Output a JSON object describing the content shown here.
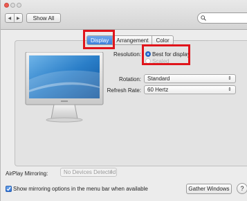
{
  "toolbar": {
    "back_glyph": "◀",
    "forward_glyph": "▶",
    "show_all_label": "Show All",
    "search": {
      "value": "",
      "placeholder": ""
    }
  },
  "tabs": [
    {
      "label": "Display",
      "active": true
    },
    {
      "label": "Arrangement",
      "active": false
    },
    {
      "label": "Color",
      "active": false
    }
  ],
  "display": {
    "resolution_label": "Resolution:",
    "resolution_options": [
      {
        "label": "Best for display",
        "selected": true
      },
      {
        "label": "Scaled",
        "selected": false
      }
    ],
    "rotation_label": "Rotation:",
    "rotation_value": "Standard",
    "refresh_label": "Refresh Rate:",
    "refresh_value": "60 Hertz"
  },
  "airplay": {
    "label": "AirPlay Mirroring:",
    "value": "No Devices Detected"
  },
  "mirroring_checkbox": {
    "label": "Show mirroring options in the menu bar when available",
    "checked": true
  },
  "gather_windows_label": "Gather Windows",
  "help_glyph": "?",
  "colors": {
    "accent": "#3b7fdc",
    "annotation": "#e0141b",
    "close": "#ee5b52"
  },
  "icons": [
    "search-icon",
    "close-icon",
    "minimize-icon",
    "zoom-icon",
    "chevron-updown-icon",
    "checkmark-icon",
    "monitor-icon"
  ]
}
